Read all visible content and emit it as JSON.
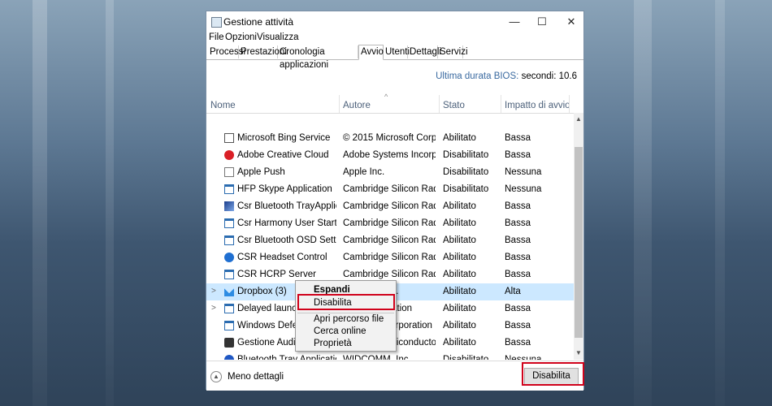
{
  "window": {
    "title": "Gestione attività",
    "controls": {
      "minimize": "—",
      "maximize": "☐",
      "close": "✕"
    }
  },
  "menubar": [
    "File",
    "Opzioni",
    "Visualizza"
  ],
  "tabs": [
    "Processi",
    "Prestazioni",
    "Cronologia applicazioni",
    "Avvio",
    "Utenti",
    "Dettagli",
    "Servizi"
  ],
  "active_tab": "Avvio",
  "bios": {
    "label": "Ultima durata BIOS:",
    "value": "secondi: 10.6"
  },
  "columns": {
    "name": "Nome",
    "publisher": "Autore",
    "state": "Stato",
    "impact": "Impatto di avvio"
  },
  "rows": [
    {
      "name": "Microsoft Bing Service",
      "publisher": "© 2015 Microsoft Corpora...",
      "state": "Abilitato",
      "impact": "Bassa",
      "icon": "bing-icon"
    },
    {
      "name": "Adobe Creative Cloud",
      "publisher": "Adobe Systems Incorporat...",
      "state": "Disabilitato",
      "impact": "Bassa",
      "icon": "adobe-icon"
    },
    {
      "name": "Apple Push",
      "publisher": "Apple Inc.",
      "state": "Disabilitato",
      "impact": "Nessuna",
      "icon": "apple-icon"
    },
    {
      "name": "HFP Skype Application",
      "publisher": "Cambridge Silicon Radio Li...",
      "state": "Disabilitato",
      "impact": "Nessuna",
      "icon": "app-window-icon"
    },
    {
      "name": "Csr Bluetooth TrayApplication",
      "publisher": "Cambridge Silicon Radio Li...",
      "state": "Abilitato",
      "impact": "Bassa",
      "icon": "bluetooth-tray-icon"
    },
    {
      "name": "Csr Harmony User Startup A...",
      "publisher": "Cambridge Silicon Radio Li...",
      "state": "Abilitato",
      "impact": "Bassa",
      "icon": "app-window-icon"
    },
    {
      "name": "Csr Bluetooth OSD Settings",
      "publisher": "Cambridge Silicon Radio Li...",
      "state": "Abilitato",
      "impact": "Bassa",
      "icon": "app-window-icon"
    },
    {
      "name": "CSR Headset Control",
      "publisher": "Cambridge Silicon Radio Li...",
      "state": "Abilitato",
      "impact": "Bassa",
      "icon": "headset-help-icon"
    },
    {
      "name": "CSR HCRP Server",
      "publisher": "Cambridge Silicon Radio Li...",
      "state": "Abilitato",
      "impact": "Bassa",
      "icon": "app-window-icon"
    },
    {
      "name": "Dropbox (3)",
      "publisher": "Dropbox, Inc.",
      "state": "Abilitato",
      "impact": "Alta",
      "icon": "dropbox-icon",
      "expandable": true,
      "selected": true
    },
    {
      "name": "Delayed launcher",
      "publisher": "Intel Corporation",
      "state": "Abilitato",
      "impact": "Bassa",
      "icon": "app-window-icon",
      "expandable": true
    },
    {
      "name": "Windows Defender",
      "publisher": "Microsoft Corporation",
      "state": "Abilitato",
      "impact": "Bassa",
      "icon": "defender-icon"
    },
    {
      "name": "Gestione Audio Realtek",
      "publisher": "Realtek Semiconductor",
      "state": "Abilitato",
      "impact": "Bassa",
      "icon": "audio-icon"
    },
    {
      "name": "Bluetooth Tray Application",
      "publisher": "WIDCOMM, Inc.",
      "state": "Disabilitato",
      "impact": "Nessuna",
      "icon": "bluetooth-icon"
    }
  ],
  "context_menu": {
    "items": [
      "Espandi",
      "Disabilita",
      "Apri percorso file",
      "Cerca online",
      "Proprietà"
    ]
  },
  "footer": {
    "less_details": "Meno dettagli",
    "disable_button": "Disabilita"
  },
  "colors": {
    "highlight": "#d0021b",
    "selection": "#cce8ff",
    "bios_label": "#3a6aa0",
    "header_text": "#4c607a"
  }
}
